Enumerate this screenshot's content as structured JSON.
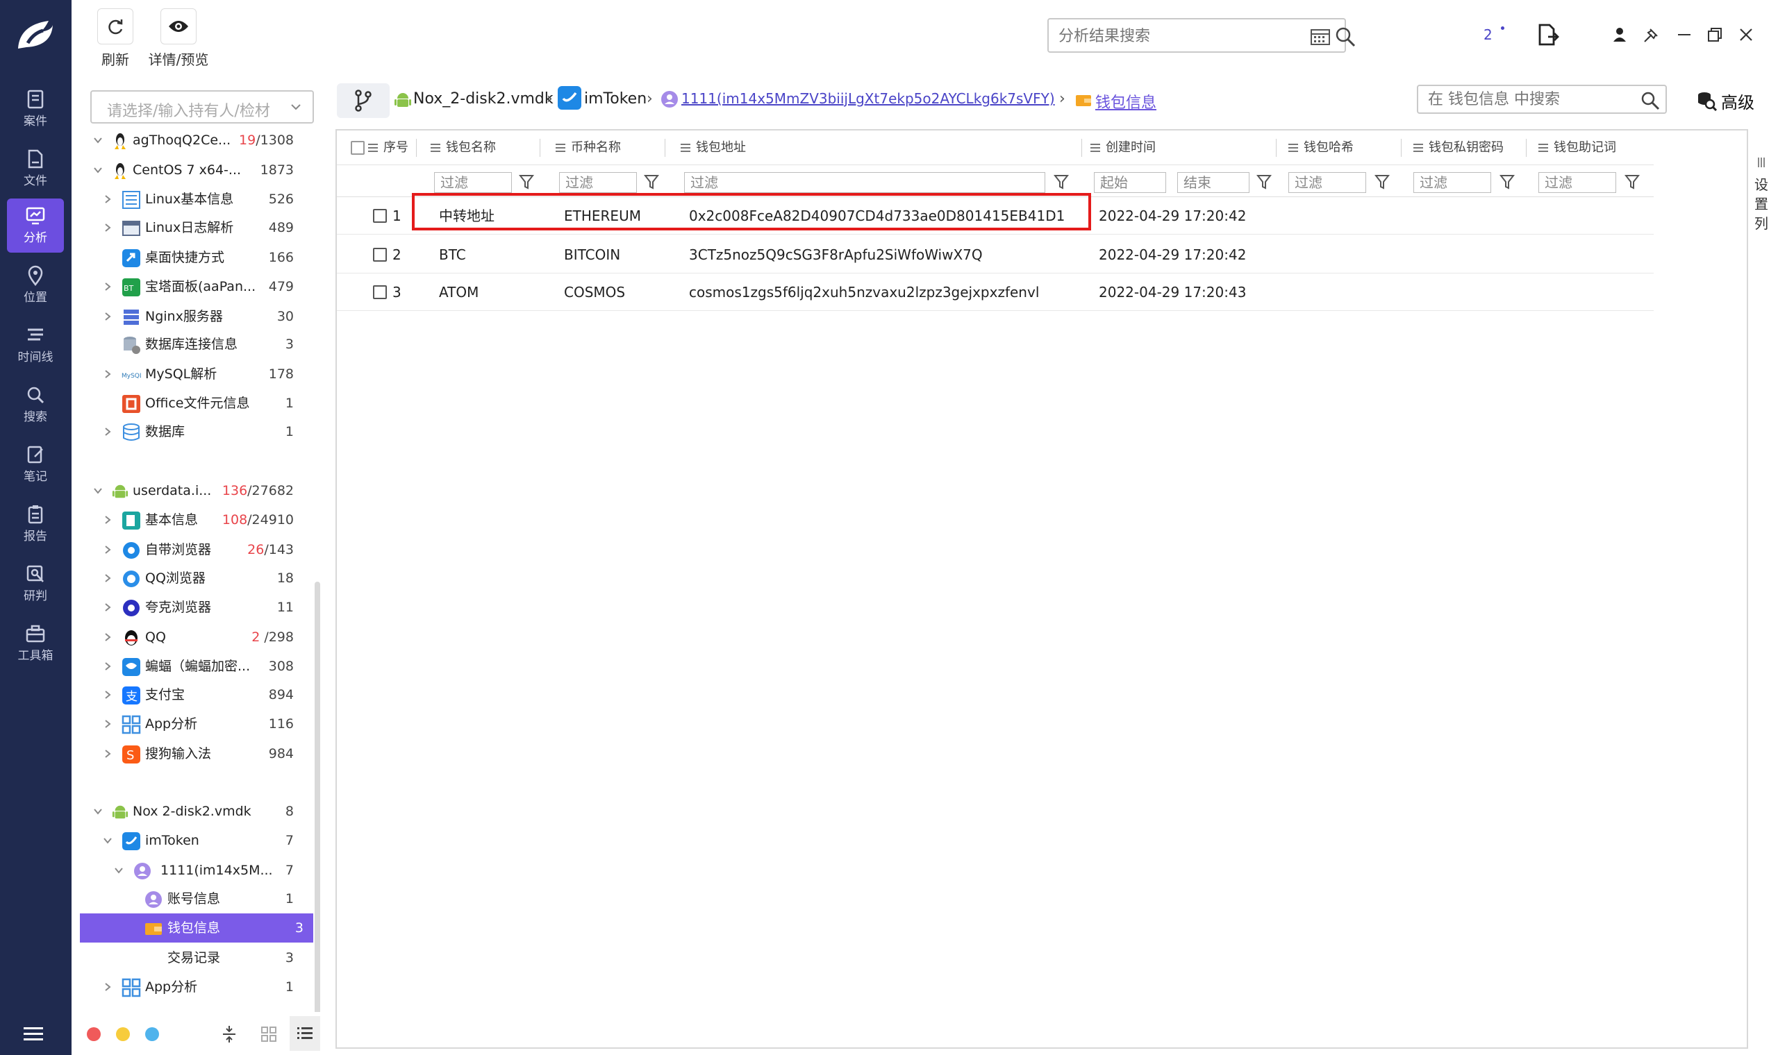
{
  "nav": {
    "items": [
      {
        "label": "案件",
        "icon": "case-icon"
      },
      {
        "label": "文件",
        "icon": "file-icon"
      },
      {
        "label": "分析",
        "icon": "analysis-icon",
        "active": true
      },
      {
        "label": "位置",
        "icon": "location-icon"
      },
      {
        "label": "时间线",
        "icon": "timeline-icon"
      },
      {
        "label": "搜索",
        "icon": "search-icon"
      },
      {
        "label": "笔记",
        "icon": "note-icon"
      },
      {
        "label": "报告",
        "icon": "report-icon"
      },
      {
        "label": "研判",
        "icon": "judge-icon"
      },
      {
        "label": "工具箱",
        "icon": "toolbox-icon"
      }
    ]
  },
  "toolbar": {
    "refresh_label": "刷新",
    "preview_label": "详情/预览",
    "search_placeholder": "分析结果搜索",
    "notify_count": "2"
  },
  "tree": {
    "holder_placeholder": "请选择/输入持有人/检材",
    "rows": [
      {
        "label": "agThoqQ2Ce...",
        "count_hl": "19",
        "count": "/1308",
        "icon": "linux-icon"
      },
      {
        "label": "CentOS 7 x64-...",
        "count": "1873",
        "icon": "linux-icon"
      },
      {
        "label": "Linux基本信息",
        "count": "526",
        "icon": "info-icon"
      },
      {
        "label": "Linux日志解析",
        "count": "489",
        "icon": "log-icon"
      },
      {
        "label": "桌面快捷方式",
        "count": "166",
        "icon": "shortcut-icon"
      },
      {
        "label": "宝塔面板(aaPan...",
        "count": "479",
        "icon": "baota-icon"
      },
      {
        "label": "Nginx服务器",
        "count": "30",
        "icon": "server-icon"
      },
      {
        "label": "数据库连接信息",
        "count": "3",
        "icon": "db-conn-icon"
      },
      {
        "label": "MySQL解析",
        "count": "178",
        "icon": "mysql-icon"
      },
      {
        "label": "Office文件元信息",
        "count": "1",
        "icon": "office-icon"
      },
      {
        "label": "数据库",
        "count": "1",
        "icon": "database-icon"
      },
      {
        "label": "userdata.i...",
        "count_hl": "136",
        "count": "/27682",
        "icon": "android-icon"
      },
      {
        "label": "基本信息",
        "count_hl": "108",
        "count": "/24910",
        "icon": "basic-info-icon"
      },
      {
        "label": "自带浏览器",
        "count_hl": "26",
        "count": "/143",
        "icon": "browser-icon"
      },
      {
        "label": "QQ浏览器",
        "count": "18",
        "icon": "qq-browser-icon"
      },
      {
        "label": "夸克浏览器",
        "count": "11",
        "icon": "quark-icon"
      },
      {
        "label": "QQ",
        "count_hl": "2",
        "count": " /298",
        "icon": "qq-icon"
      },
      {
        "label": "蝙蝠（蝙蝠加密...",
        "count": "308",
        "icon": "bat-icon"
      },
      {
        "label": "支付宝",
        "count": "894",
        "icon": "alipay-icon"
      },
      {
        "label": "App分析",
        "count": "116",
        "icon": "app-icon"
      },
      {
        "label": "搜狗输入法",
        "count": "984",
        "icon": "sogou-icon"
      },
      {
        "label": "Nox 2-disk2.vmdk",
        "count": "8",
        "icon": "android-icon"
      },
      {
        "label": "imToken",
        "count": "7",
        "icon": "imtoken-icon"
      },
      {
        "label": "1111(im14x5M...",
        "count": "7",
        "icon": "account-icon"
      },
      {
        "label": "账号信息",
        "count": "1",
        "icon": "account-icon"
      },
      {
        "label": "钱包信息",
        "count": "3",
        "icon": "wallet-icon",
        "selected": true
      },
      {
        "label": "交易记录",
        "count": "3",
        "icon": ""
      },
      {
        "label": "App分析",
        "count": "1",
        "icon": "app-icon"
      }
    ]
  },
  "breadcrumb": {
    "items": [
      "Nox_2-disk2.vmdk",
      "imToken",
      "1111(im14x5MmZV3biijLgXt7ekp5o2AYCLkg6k7sVFY)",
      "钱包信息"
    ],
    "search_placeholder": "在 钱包信息 中搜索",
    "advanced_label": "高级"
  },
  "table": {
    "columns": [
      "序号",
      "钱包名称",
      "币种名称",
      "钱包地址",
      "创建时间",
      "钱包哈希",
      "钱包私钥密码",
      "钱包助记词"
    ],
    "filter_placeholder": "过滤",
    "start_placeholder": "起始",
    "end_placeholder": "结束",
    "rows": [
      {
        "no": "1",
        "name": "中转地址",
        "coin": "ETHEREUM",
        "address": "0x2c008FceA82D40907CD4d733ae0D801415EB41D1",
        "time": "2022-04-29 17:20:42"
      },
      {
        "no": "2",
        "name": "BTC",
        "coin": "BITCOIN",
        "address": "3CTz5noz5Q9cSG3F8rApfu2SiWfoWiwX7Q",
        "time": "2022-04-29 17:20:42"
      },
      {
        "no": "3",
        "name": "ATOM",
        "coin": "COSMOS",
        "address": "cosmos1zgs5f6ljq2xuh5nzvaxu2lzpz3gejxpxzfenvl",
        "time": "2022-04-29 17:20:43"
      }
    ],
    "settings_label": "设置列"
  },
  "colors": {
    "nav_bg": "#1f2a4f",
    "accent": "#7b5be8",
    "highlight_box": "#e41b1b",
    "count_red": "#e8444a"
  }
}
